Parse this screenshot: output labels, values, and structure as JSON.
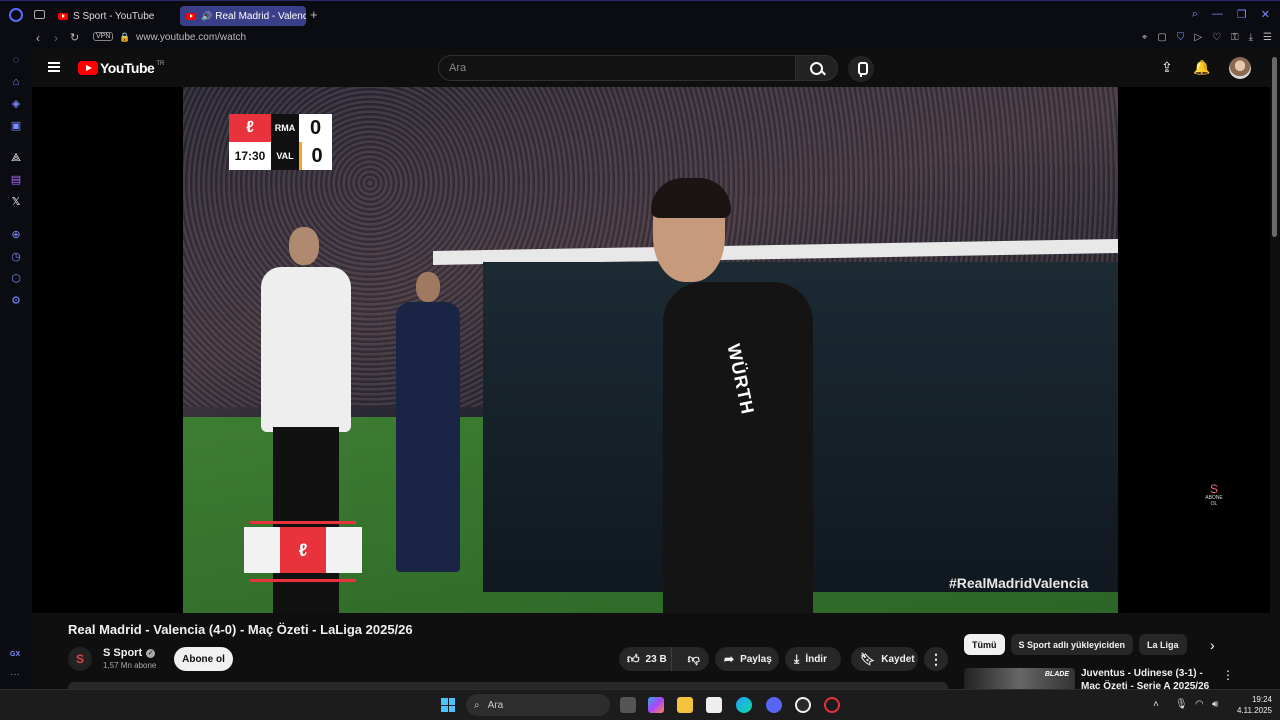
{
  "browser": {
    "tabs": [
      {
        "label": "S Sport - YouTube"
      },
      {
        "label": "Real Madrid - Valencia"
      }
    ],
    "new_tab": "+",
    "vpn": "VPN",
    "url": "www.youtube.com/watch"
  },
  "youtube": {
    "logo_text": "YouTube",
    "region": "TR",
    "search_placeholder": "Ara"
  },
  "player": {
    "scoreboard": {
      "home_team": "RMA",
      "away_team": "VAL",
      "home_score": "0",
      "away_score": "0",
      "clock": "17:30"
    },
    "hashtag": "#RealMadridValencia",
    "watermark": "ABONE OL",
    "sponsor": "WÜRTH"
  },
  "video": {
    "title": "Real Madrid - Valencia (4-0) - Maç Özeti - LaLiga 2025/26",
    "channel_name": "S Sport",
    "channel_avatar": "S",
    "subscribers": "1,57 Mn abone",
    "subscribe_label": "Abone ol",
    "likes": "23 B",
    "share_label": "Paylaş",
    "download_label": "İndir",
    "save_label": "Kaydet",
    "more": "⋮"
  },
  "recommendations": {
    "chips": [
      "Tümü",
      "S Sport adlı yükleyiciden",
      "La Liga"
    ],
    "items": [
      {
        "title": "Juventus - Udinese (3-1) - Maç Özeti - Serie A 2025/26",
        "thumb_label": "BLADE"
      }
    ]
  },
  "taskbar": {
    "search_placeholder": "Ara",
    "time": "19:24",
    "date": "4.11.2025"
  },
  "colors": {
    "accent": "#7d8cff",
    "youtube_red": "#ff0000",
    "laliga_red": "#e8323c",
    "active_tab": "#3a3f8a"
  }
}
